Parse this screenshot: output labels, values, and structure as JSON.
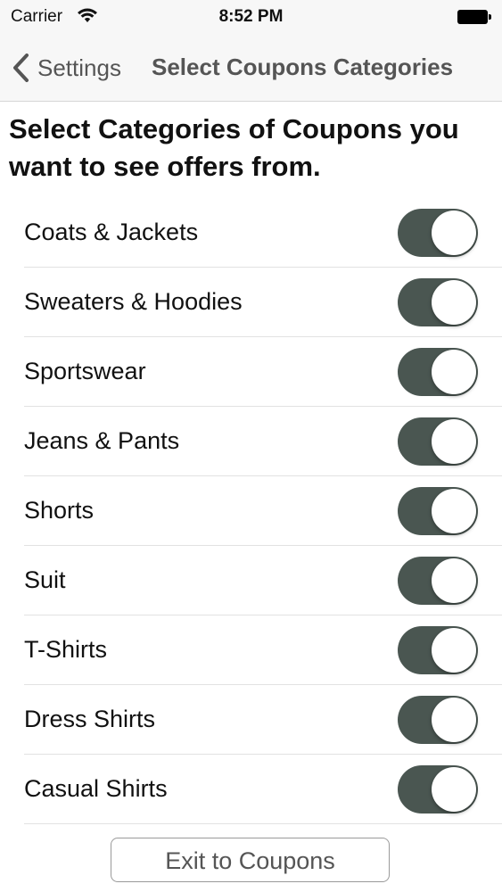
{
  "status_bar": {
    "carrier": "Carrier",
    "time": "8:52 PM",
    "icons": [
      "wifi-icon",
      "battery-icon"
    ]
  },
  "nav": {
    "back_label": "Settings",
    "title": "Select Coupons Categories",
    "back_icon": "chevron-left-icon"
  },
  "instructions": "Select Categories of Coupons you want to see offers from.",
  "categories": [
    {
      "label": "Coats & Jackets",
      "enabled": true
    },
    {
      "label": "Sweaters & Hoodies",
      "enabled": true
    },
    {
      "label": "Sportswear",
      "enabled": true
    },
    {
      "label": "Jeans & Pants",
      "enabled": true
    },
    {
      "label": "Shorts",
      "enabled": true
    },
    {
      "label": "Suit",
      "enabled": true
    },
    {
      "label": "T-Shirts",
      "enabled": true
    },
    {
      "label": "Dress Shirts",
      "enabled": true
    },
    {
      "label": "Casual Shirts",
      "enabled": true
    }
  ],
  "exit_button_label": "Exit to Coupons",
  "colors": {
    "toggle_on": "#4a5651",
    "nav_text": "#555555"
  }
}
